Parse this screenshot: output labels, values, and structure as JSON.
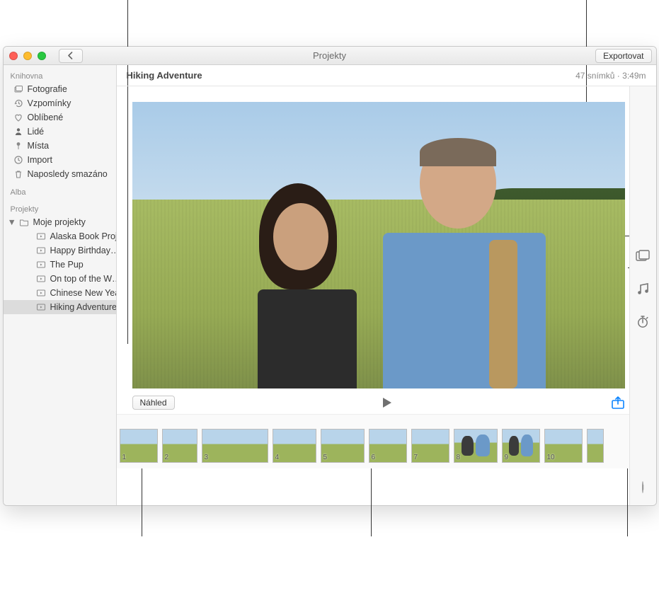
{
  "window": {
    "title": "Projekty",
    "export_label": "Exportovat"
  },
  "sidebar": {
    "sections": {
      "library": "Knihovna",
      "albums": "Alba",
      "projects": "Projekty"
    },
    "library_items": [
      {
        "label": "Fotografie",
        "icon": "photo-stack-icon"
      },
      {
        "label": "Vzpomínky",
        "icon": "clock-back-icon"
      },
      {
        "label": "Oblíbené",
        "icon": "heart-icon"
      },
      {
        "label": "Lidé",
        "icon": "person-icon"
      },
      {
        "label": "Místa",
        "icon": "pin-icon"
      },
      {
        "label": "Import",
        "icon": "clock-icon"
      },
      {
        "label": "Naposledy smazáno",
        "icon": "trash-icon"
      }
    ],
    "my_projects_label": "Moje projekty",
    "projects": [
      "Alaska Book Proj…",
      "Happy Birthday…",
      "The Pup",
      "On top of the W…",
      "Chinese New Year",
      "Hiking Adventure"
    ],
    "selected_project_index": 5
  },
  "project": {
    "title": "Hiking Adventure",
    "frame_count_label": "47 snímků",
    "duration_label": "3:49m",
    "preview_button": "Náhled"
  },
  "thumbnails": {
    "labels": [
      "1",
      "2",
      "3",
      "4",
      "5",
      "6",
      "7",
      "8",
      "9",
      "10"
    ]
  },
  "icons": {
    "back": "chevron-left-icon",
    "play": "play-icon",
    "share": "share-icon",
    "theme": "theme-icon",
    "music": "music-icon",
    "duration": "stopwatch-icon",
    "add": "plus-circle-icon"
  }
}
